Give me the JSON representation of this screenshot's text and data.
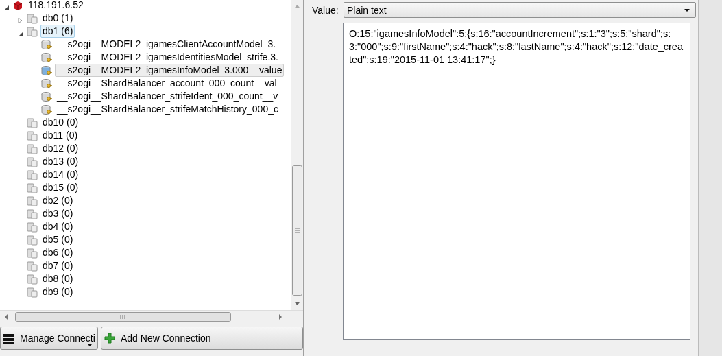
{
  "tree": {
    "label": "118.191.6.52",
    "kind": "server",
    "expanded": true,
    "selected": false,
    "children": [
      {
        "label": "db0 (1)",
        "kind": "database",
        "expanded": false,
        "selected": false,
        "has_children": true
      },
      {
        "label": "db1 (6)",
        "kind": "database",
        "expanded": true,
        "selected": true,
        "has_children": true,
        "children": [
          {
            "label": "__s2ogi__MODEL2_igamesClientAccountModel_3.",
            "kind": "key",
            "selected": false
          },
          {
            "label": "__s2ogi__MODEL2_igamesIdentitiesModel_strife.3.",
            "kind": "key",
            "selected": false
          },
          {
            "label": "__s2ogi__MODEL2_igamesInfoModel_3.000__value",
            "kind": "key",
            "selected": true
          },
          {
            "label": "__s2ogi__ShardBalancer_account_000_count__val",
            "kind": "key",
            "selected": false
          },
          {
            "label": "__s2ogi__ShardBalancer_strifeIdent_000_count__v",
            "kind": "key",
            "selected": false
          },
          {
            "label": "__s2ogi__ShardBalancer_strifeMatchHistory_000_c",
            "kind": "key",
            "selected": false
          }
        ]
      },
      {
        "label": "db10 (0)",
        "kind": "database",
        "selected": false
      },
      {
        "label": "db11 (0)",
        "kind": "database",
        "selected": false
      },
      {
        "label": "db12 (0)",
        "kind": "database",
        "selected": false
      },
      {
        "label": "db13 (0)",
        "kind": "database",
        "selected": false
      },
      {
        "label": "db14 (0)",
        "kind": "database",
        "selected": false
      },
      {
        "label": "db15 (0)",
        "kind": "database",
        "selected": false
      },
      {
        "label": "db2 (0)",
        "kind": "database",
        "selected": false
      },
      {
        "label": "db3 (0)",
        "kind": "database",
        "selected": false
      },
      {
        "label": "db4 (0)",
        "kind": "database",
        "selected": false
      },
      {
        "label": "db5 (0)",
        "kind": "database",
        "selected": false
      },
      {
        "label": "db6 (0)",
        "kind": "database",
        "selected": false
      },
      {
        "label": "db7 (0)",
        "kind": "database",
        "selected": false
      },
      {
        "label": "db8 (0)",
        "kind": "database",
        "selected": false
      },
      {
        "label": "db9 (0)",
        "kind": "database",
        "selected": false
      }
    ]
  },
  "buttons": [
    {
      "label": "Manage Connecti",
      "kind": "menu"
    },
    {
      "label": "Add New Connection",
      "kind": "add"
    }
  ],
  "value_panel": {
    "label": "Value:",
    "format": "Plain text",
    "value": "O:15:\"igamesInfoModel\":5:{s:16:\"accountIncrement\";s:1:\"3\";s:5:\"shard\";s:3:\"000\";s:9:\"firstName\";s:4:\"hack\";s:8:\"lastName\";s:4:\"hack\";s:12:\"date_created\";s:19:\"2015-11-01 13:41:17\";}"
  }
}
